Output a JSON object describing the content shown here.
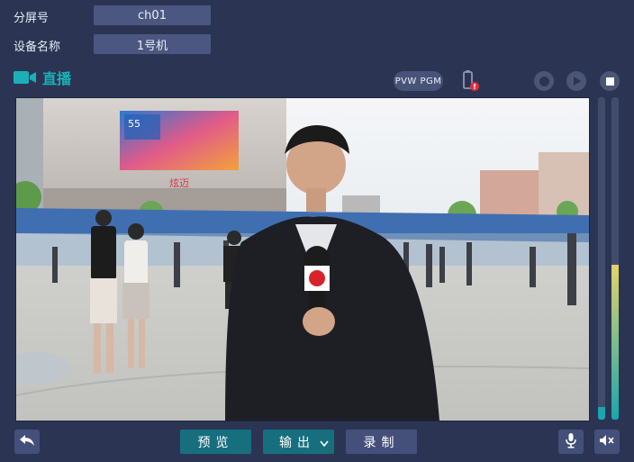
{
  "fields": {
    "screen_label": "分屏号",
    "screen_value": "ch01",
    "device_label": "设备名称",
    "device_value": "1号机"
  },
  "live": {
    "title": "直播",
    "icon": "video-camera-icon"
  },
  "toolbar": {
    "pvw_pgm": "PVW PGM",
    "icons": [
      "battery-warning-icon",
      "record-icon",
      "play-icon",
      "stop-icon"
    ]
  },
  "video": {
    "description_icon": "live-video-feed",
    "mic_logo_text": "",
    "store_sign": "炫迈",
    "screen_text": "55"
  },
  "meters": {
    "left_level": 0.04,
    "right_level": 0.48,
    "colors": {
      "track": "#414c6d",
      "low": "#1aa6ae",
      "high": "#e3d36a"
    }
  },
  "bottom": {
    "back_icon": "back-arrow-icon",
    "preview_label": "预览",
    "output_label": "输出",
    "record_label": "录制",
    "mic_icon": "microphone-icon",
    "mute_icon": "mute-speaker-icon"
  }
}
